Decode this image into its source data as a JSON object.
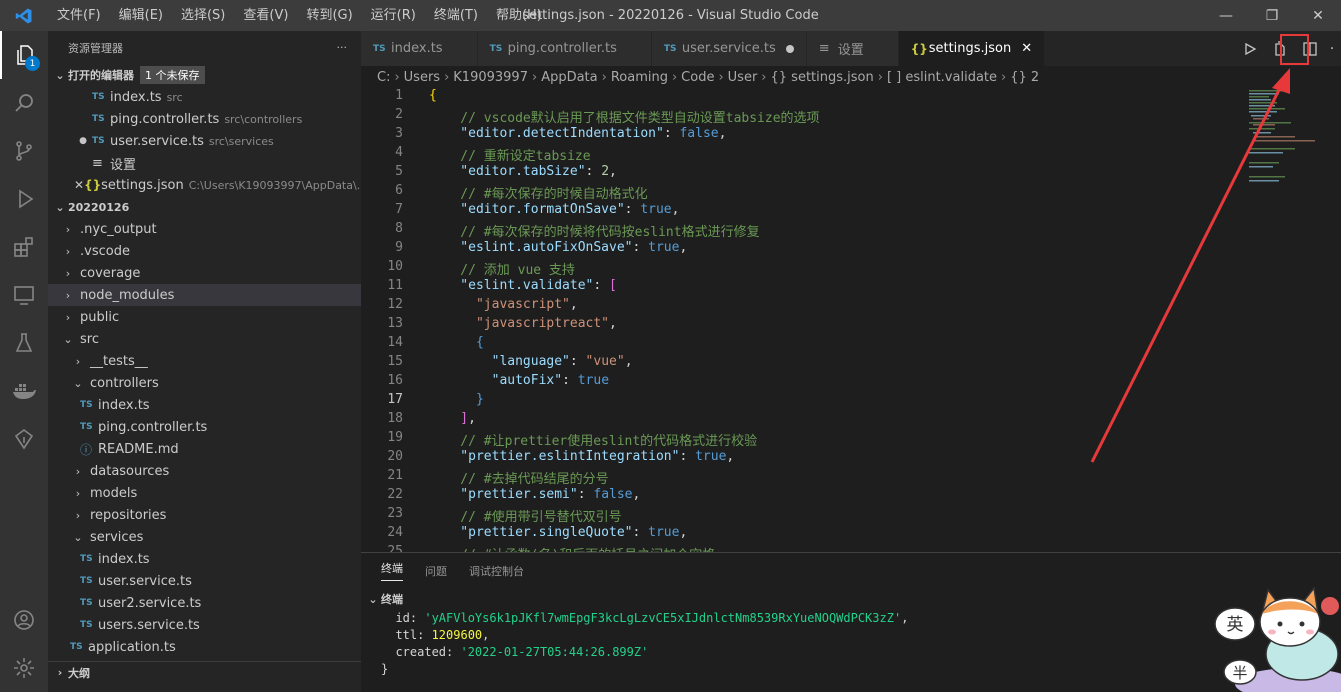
{
  "titlebar": {
    "menu": [
      "文件(F)",
      "编辑(E)",
      "选择(S)",
      "查看(V)",
      "转到(G)",
      "运行(R)",
      "终端(T)",
      "帮助(H)"
    ],
    "title": "settings.json - 20220126 - Visual Studio Code",
    "controls": [
      "—",
      "❐",
      "✕"
    ]
  },
  "activity": {
    "explorer_badge": "1"
  },
  "sidebar": {
    "header": "资源管理器",
    "more": "···",
    "open_editors": {
      "title": "打开的编辑器",
      "unsaved": "1 个未保存",
      "items": [
        {
          "icon": "TS",
          "name": "index.ts",
          "desc": "src"
        },
        {
          "icon": "TS",
          "name": "ping.controller.ts",
          "desc": "src\\controllers"
        },
        {
          "icon": "TS",
          "name": "user.service.ts",
          "desc": "src\\services"
        },
        {
          "icon": "≡",
          "name": "设置",
          "desc": ""
        },
        {
          "icon": "{}",
          "name": "settings.json",
          "desc": "C:\\Users\\K19093997\\AppData\\..."
        }
      ]
    },
    "folder": {
      "title": "20220126",
      "items": [
        {
          "type": "folder",
          "name": ".nyc_output",
          "level": 1,
          "chev": "›"
        },
        {
          "type": "folder",
          "name": ".vscode",
          "level": 1,
          "chev": "›"
        },
        {
          "type": "folder",
          "name": "coverage",
          "level": 1,
          "chev": "›"
        },
        {
          "type": "folder",
          "name": "node_modules",
          "level": 1,
          "chev": "›"
        },
        {
          "type": "folder",
          "name": "public",
          "level": 1,
          "chev": "›"
        },
        {
          "type": "folder",
          "name": "src",
          "level": 1,
          "chev": "⌄"
        },
        {
          "type": "folder",
          "name": "__tests__",
          "level": 2,
          "chev": "›"
        },
        {
          "type": "folder",
          "name": "controllers",
          "level": 2,
          "chev": "⌄"
        },
        {
          "type": "ts",
          "name": "index.ts",
          "level": 3
        },
        {
          "type": "ts",
          "name": "ping.controller.ts",
          "level": 3
        },
        {
          "type": "info",
          "name": "README.md",
          "level": 3
        },
        {
          "type": "folder",
          "name": "datasources",
          "level": 2,
          "chev": "›"
        },
        {
          "type": "folder",
          "name": "models",
          "level": 2,
          "chev": "›"
        },
        {
          "type": "folder",
          "name": "repositories",
          "level": 2,
          "chev": "›"
        },
        {
          "type": "folder",
          "name": "services",
          "level": 2,
          "chev": "⌄"
        },
        {
          "type": "ts",
          "name": "index.ts",
          "level": 3
        },
        {
          "type": "ts",
          "name": "user.service.ts",
          "level": 3
        },
        {
          "type": "ts",
          "name": "user2.service.ts",
          "level": 3
        },
        {
          "type": "ts",
          "name": "users.service.ts",
          "level": 3
        },
        {
          "type": "ts",
          "name": "application.ts",
          "level": 2
        }
      ]
    },
    "outline": "大纲"
  },
  "tabs": [
    {
      "icon": "TS",
      "label": "index.ts"
    },
    {
      "icon": "TS",
      "label": "ping.controller.ts"
    },
    {
      "icon": "TS",
      "label": "user.service.ts",
      "dirty": true
    },
    {
      "icon": "≡",
      "label": "设置"
    },
    {
      "icon": "{}",
      "label": "settings.json",
      "active": true
    }
  ],
  "breadcrumbs": [
    "C:",
    "Users",
    "K19093997",
    "AppData",
    "Roaming",
    "Code",
    "User",
    "{} settings.json",
    "[ ] eslint.validate",
    "{} 2"
  ],
  "editor": {
    "current_line": 17,
    "lines": [
      [
        [
          "y",
          "{"
        ]
      ],
      [
        [
          "c",
          "    // vscode默认启用了根据文件类型自动设置tabsize的选项"
        ]
      ],
      [
        [
          "k",
          "    \"editor.detectIndentation\""
        ],
        [
          "p",
          ": "
        ],
        [
          "b",
          "false"
        ],
        [
          "p",
          ","
        ]
      ],
      [
        [
          "c",
          "    // 重新设定tabsize"
        ]
      ],
      [
        [
          "k",
          "    \"editor.tabSize\""
        ],
        [
          "p",
          ": "
        ],
        [
          "n",
          "2"
        ],
        [
          "p",
          ","
        ]
      ],
      [
        [
          "c",
          "    // #每次保存的时候自动格式化"
        ]
      ],
      [
        [
          "k",
          "    \"editor.formatOnSave\""
        ],
        [
          "p",
          ": "
        ],
        [
          "b",
          "true"
        ],
        [
          "p",
          ","
        ]
      ],
      [
        [
          "c",
          "    // #每次保存的时候将代码按eslint格式进行修复"
        ]
      ],
      [
        [
          "k",
          "    \"eslint.autoFixOnSave\""
        ],
        [
          "p",
          ": "
        ],
        [
          "b",
          "true"
        ],
        [
          "p",
          ","
        ]
      ],
      [
        [
          "c",
          "    // 添加 vue 支持"
        ]
      ],
      [
        [
          "k",
          "    \"eslint.validate\""
        ],
        [
          "p",
          ": "
        ],
        [
          "m",
          "["
        ]
      ],
      [
        [
          "s",
          "      \"javascript\""
        ],
        [
          "p",
          ","
        ]
      ],
      [
        [
          "s",
          "      \"javascriptreact\""
        ],
        [
          "p",
          ","
        ]
      ],
      [
        [
          "b",
          "      {"
        ]
      ],
      [
        [
          "k",
          "        \"language\""
        ],
        [
          "p",
          ": "
        ],
        [
          "s",
          "\"vue\""
        ],
        [
          "p",
          ","
        ]
      ],
      [
        [
          "k",
          "        \"autoFix\""
        ],
        [
          "p",
          ": "
        ],
        [
          "b",
          "true"
        ]
      ],
      [
        [
          "b",
          "      }"
        ]
      ],
      [
        [
          "m",
          "    ]"
        ],
        [
          "p",
          ","
        ]
      ],
      [
        [
          "c",
          "    // #让prettier使用eslint的代码格式进行校验"
        ]
      ],
      [
        [
          "k",
          "    \"prettier.eslintIntegration\""
        ],
        [
          "p",
          ": "
        ],
        [
          "b",
          "true"
        ],
        [
          "p",
          ","
        ]
      ],
      [
        [
          "c",
          "    // #去掉代码结尾的分号"
        ]
      ],
      [
        [
          "k",
          "    \"prettier.semi\""
        ],
        [
          "p",
          ": "
        ],
        [
          "b",
          "false"
        ],
        [
          "p",
          ","
        ]
      ],
      [
        [
          "c",
          "    // #使用带引号替代双引号"
        ]
      ],
      [
        [
          "k",
          "    \"prettier.singleQuote\""
        ],
        [
          "p",
          ": "
        ],
        [
          "b",
          "true"
        ],
        [
          "p",
          ","
        ]
      ],
      [
        [
          "c",
          "    // #让函数(名)和后面的括号之间加个空格"
        ]
      ]
    ]
  },
  "panel": {
    "tabs": [
      "终端",
      "问题",
      "调试控制台"
    ],
    "section": "终端",
    "terminal": [
      [
        [
          "p",
          "  id: "
        ],
        [
          "tg",
          "'yAFVloYs6k1pJKfl7wmEpgF3kcLgLzvCE5xIJdnlctNm8539RxYueNOQWdPCK3zZ'"
        ],
        [
          "p",
          ","
        ]
      ],
      [
        [
          "p",
          "  ttl: "
        ],
        [
          "ty",
          "1209600"
        ],
        [
          "p",
          ","
        ]
      ],
      [
        [
          "p",
          "  created: "
        ],
        [
          "tg",
          "'2022-01-27T05:44:26.899Z'"
        ]
      ],
      [
        [
          "p",
          "}"
        ]
      ]
    ]
  },
  "mascot": {
    "text1": "英",
    "text2": "半"
  }
}
